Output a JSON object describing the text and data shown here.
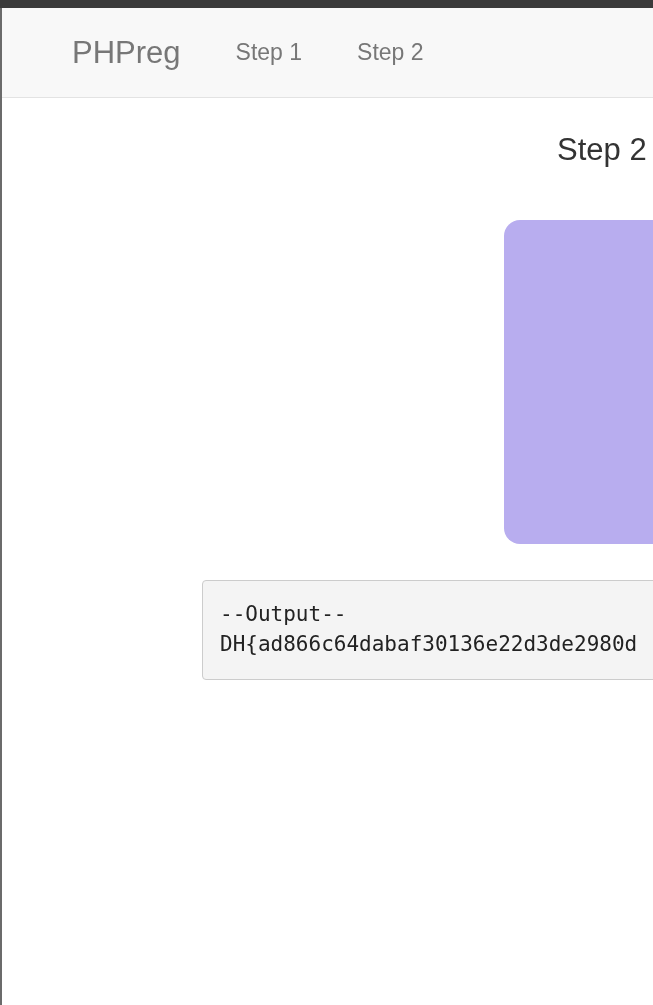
{
  "navbar": {
    "brand": "PHPreg",
    "links": [
      {
        "label": "Step 1"
      },
      {
        "label": "Step 2"
      }
    ]
  },
  "heading": "Step 2",
  "output": {
    "lines": [
      "--Output--",
      "DH{ad866c64dabaf30136e22d3de2980d"
    ]
  }
}
